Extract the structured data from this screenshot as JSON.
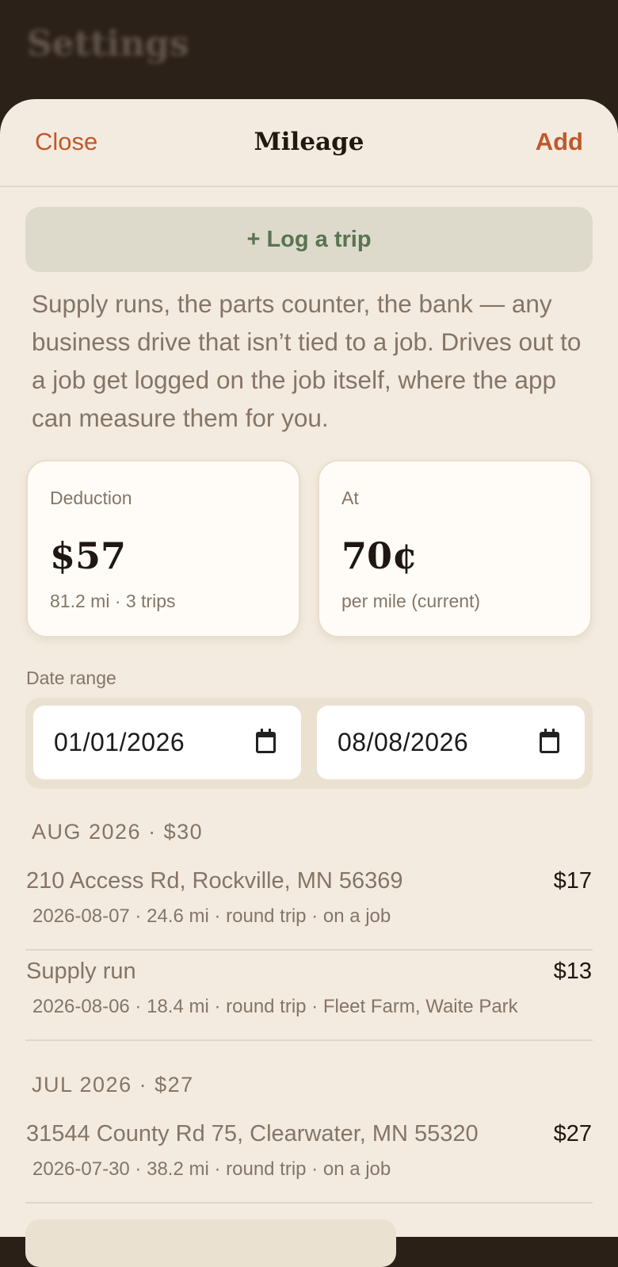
{
  "backdrop": {
    "title": "Settings"
  },
  "header": {
    "close_label": "Close",
    "title": "Mileage",
    "add_label": "Add"
  },
  "log_button": "+ Log a trip",
  "intro_text": "Supply runs, the parts counter, the bank — any business drive that isn’t tied to a job. Drives out to a job get logged on the job itself, where the app can measure them for you.",
  "summary": {
    "deduction": {
      "label": "Deduction",
      "value": "$57",
      "sub": "81.2 mi · 3 trips"
    },
    "rate": {
      "label": "At",
      "value": "70¢",
      "sub": "per mile (current)"
    }
  },
  "date_range": {
    "label": "Date range",
    "from": "01/01/2026",
    "to": "08/08/2026"
  },
  "groups": [
    {
      "header": "AUG 2026 · $30",
      "trips": [
        {
          "title": "210 Access Rd, Rockville, MN 56369",
          "amount": "$17",
          "meta": "2026-08-07 · 24.6 mi · round trip · on a job"
        },
        {
          "title": "Supply run",
          "amount": "$13",
          "meta": "2026-08-06 · 18.4 mi · round trip · Fleet Farm, Waite Park"
        }
      ]
    },
    {
      "header": "JUL 2026 · $27",
      "trips": [
        {
          "title": "31544 County Rd 75, Clearwater, MN 55320",
          "amount": "$27",
          "meta": "2026-07-30 · 38.2 mi · round trip · on a job"
        }
      ]
    }
  ],
  "colors": {
    "accent": "#c0582d",
    "sheet_bg": "#f3ebdf",
    "green": "#5a7350",
    "muted_text": "#857566"
  }
}
